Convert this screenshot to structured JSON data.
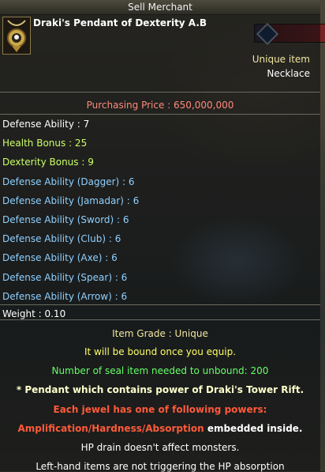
{
  "header": {
    "title": "Sell Merchant"
  },
  "item": {
    "name": "Draki's Pendant of Dexterity A.B",
    "rarity": "Unique item",
    "type": "Necklace",
    "icon": "pendant-icon"
  },
  "price": "Purchasing Price : 650,000,000",
  "stats": [
    {
      "text": "Defense Ability : 7",
      "color": "#ffffff"
    },
    {
      "text": "Health Bonus : 25",
      "color": "#ccff66"
    },
    {
      "text": "Dexterity Bonus : 9",
      "color": "#ccff66"
    },
    {
      "text": "Defense Ability (Dagger) : 6",
      "color": "#8fd0ff"
    },
    {
      "text": "Defense Ability (Jamadar) : 6",
      "color": "#8fd0ff"
    },
    {
      "text": "Defense Ability (Sword) : 6",
      "color": "#8fd0ff"
    },
    {
      "text": "Defense Ability (Club) : 6",
      "color": "#8fd0ff"
    },
    {
      "text": "Defense Ability (Axe) : 6",
      "color": "#8fd0ff"
    },
    {
      "text": "Defense Ability (Spear) : 6",
      "color": "#8fd0ff"
    },
    {
      "text": "Defense Ability (Arrow) : 6",
      "color": "#8fd0ff"
    }
  ],
  "weight": "Weight : 0.10",
  "grade": "Item Grade : Unique",
  "bound_note": "It will be bound once you equip.",
  "seal_note": "Number of seal item needed to unbound: 200",
  "description": "* Pendant which contains power of Draki's Tower Rift.",
  "jewel_note": "Each jewel has one of following powers:",
  "powers": "Amplification/Hardness/Absorption",
  "powers_suffix": " embedded inside.",
  "hp_drain": "HP drain doesn't affect monsters.",
  "left_hand": "Left-hand items are not triggering the HP absorption",
  "colors": {
    "grade": "#f2e6a0",
    "bound": "#ffff66",
    "seal": "#66ff66",
    "description": "#ffffcc",
    "jewel": "#ff5a3a",
    "white": "#ffffff"
  }
}
